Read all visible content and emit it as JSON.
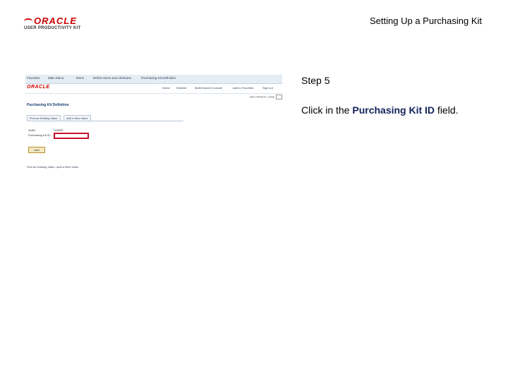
{
  "logo": {
    "brand": "ORACLE",
    "product": "USER PRODUCTIVITY KIT"
  },
  "doc_title": "Setting Up a Purchasing Kit",
  "step": "Step 5",
  "instruction": {
    "before": "Click in the ",
    "bold": "Purchasing Kit ID",
    "after": " field."
  },
  "screenshot": {
    "topbar": [
      "Favorites",
      "Main Menu",
      "Items",
      "Define Items and Attributes",
      "Purchasing Kit Definition"
    ],
    "brand": "ORACLE",
    "nav": [
      "Home",
      "Worklist",
      "MultiChannel Console",
      "Add to Favorites",
      "Sign out"
    ],
    "subnav": "New Window | Help",
    "page_heading": "Purchasing Kit Definition",
    "tabs": [
      "Find an Existing Value",
      "Add a New Value"
    ],
    "setid_label": "SetID:",
    "setid_value": "SHARE",
    "kit_label": "Purchasing Kit ID:",
    "kit_value": "",
    "add_button": "Add",
    "footer_links": "Find an Existing Value | Add a New Value"
  },
  "colors": {
    "highlight": "#c8102e",
    "brand": "#cc0000",
    "emphasis": "#13235b"
  }
}
